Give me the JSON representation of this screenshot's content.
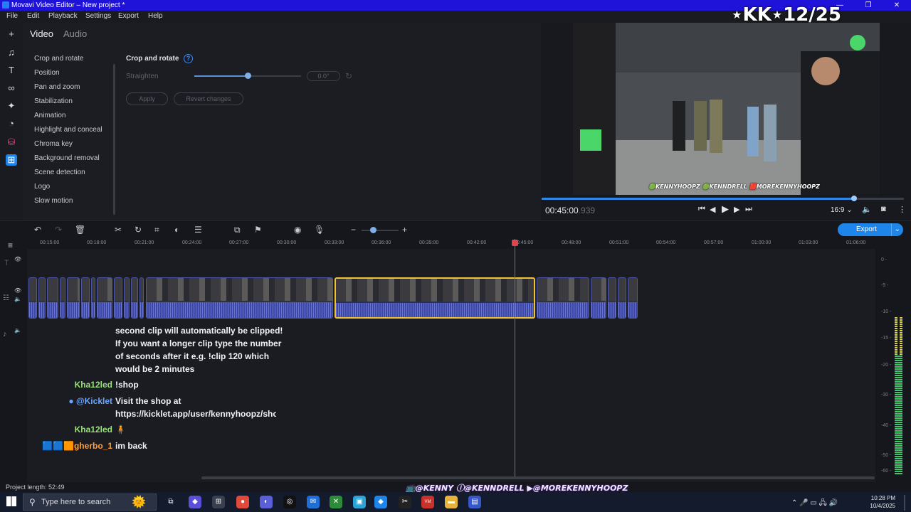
{
  "window": {
    "title": "Movavi Video Editor – New project *",
    "controls": [
      "—",
      "❐",
      "✕"
    ]
  },
  "menu": [
    "File",
    "Edit",
    "Playback",
    "Settings",
    "Export",
    "Help"
  ],
  "overlay_title": "⋆KK⋆12/25",
  "tabs": {
    "video": "Video",
    "audio": "Audio"
  },
  "features": [
    "Crop and rotate",
    "Position",
    "Pan and zoom",
    "Stabilization",
    "Animation",
    "Highlight and conceal",
    "Chroma key",
    "Background removal",
    "Scene detection",
    "Logo",
    "Slow motion"
  ],
  "crop": {
    "title": "Crop and rotate",
    "straighten_label": "Straighten",
    "angle": "0.0°",
    "apply": "Apply",
    "revert": "Revert changes",
    "straighten_level": 0.5
  },
  "preview": {
    "stream_tags": "🟢KENNYHOOPZ 🟢KENNDRELL 🟥MOREKENNYHOOPZ",
    "timecode_main": "00:45:00",
    "timecode_ms": ".939",
    "aspect": "16:9 ⌄",
    "progress": 0.9
  },
  "export_label": "Export",
  "ruler_ticks": [
    "00:15:00",
    "00:18:00",
    "00:21:00",
    "00:24:00",
    "00:27:00",
    "00:30:00",
    "00:33:00",
    "00:36:00",
    "00:39:00",
    "00:42:00",
    "00:45:00",
    "00:48:00",
    "00:51:00",
    "00:54:00",
    "00:57:00",
    "01:00:00",
    "01:03:00",
    "01:06:00"
  ],
  "chat": {
    "bot_lines": [
      "second clip will automatically be clipped!",
      "If you want a longer clip type the number",
      "of seconds after it e.g. !clip 120 which",
      "would be 2 minutes"
    ],
    "messages": [
      {
        "user": "Kha12led",
        "text": "!shop",
        "color": "#9be07a"
      },
      {
        "user": "● @Kicklet",
        "text": "Visit the shop at",
        "text2": "https://kicklet.app/user/kennyhoopz/shop",
        "color": "#6aa6ff"
      },
      {
        "user": "Kha12led",
        "text": "🧍",
        "color": "#9be07a"
      },
      {
        "user": "🟦🟦🟧gherbo_1",
        "text": "im back",
        "color": "#ff9f3a"
      }
    ]
  },
  "vu_scale": [
    "0 -",
    "-5 -",
    "-10 -",
    "-15 -",
    "-20 -",
    "-30 -",
    "-40 -",
    "-50 -",
    "-60 -"
  ],
  "project_length": "Project length: 52:49",
  "socials": "📺@KENNY  ⓘ@KENNDRELL  ▶@MOREKENNYHOOPZ",
  "taskbar": {
    "search_placeholder": "Type here to search",
    "time": "10:28 PM",
    "date": "10/4/2025"
  }
}
